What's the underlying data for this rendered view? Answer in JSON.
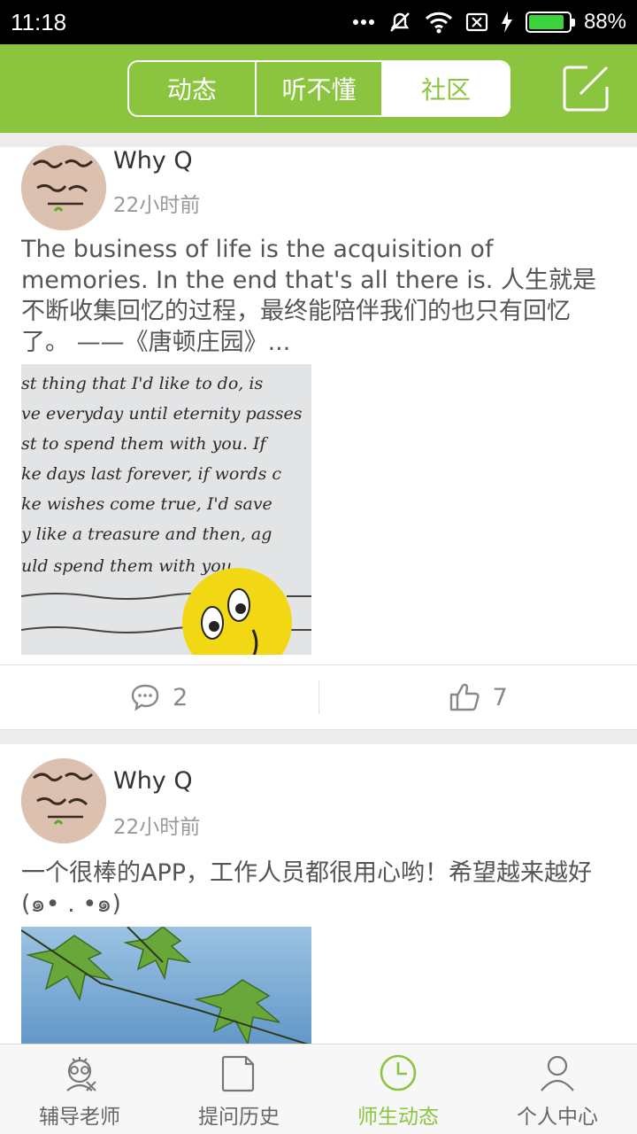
{
  "status": {
    "time": "11:18",
    "battery": "88%",
    "battery_level": 0.88
  },
  "header": {
    "tabs": [
      {
        "label": "动态",
        "active": false
      },
      {
        "label": "听不懂",
        "active": false
      },
      {
        "label": "社区",
        "active": true
      }
    ],
    "compose_icon": "compose-icon"
  },
  "posts": [
    {
      "user": "Why Q",
      "time": "22小时前",
      "text": "The business of life is the acquisition of memories. In the end that's all there is. 人生就是不断收集回忆的过程，最终能陪伴我们的也只有回忆了。 ——《唐顿庄园》...",
      "image_lines": [
        "st thing that I'd like to do, is",
        "ve everyday until eternity passes",
        "st to spend them with you. If",
        "ke days last forever, if words c",
        "ke wishes come true, I'd save",
        "y like a treasure and then, ag",
        "uld spend them with you."
      ],
      "comments": "2",
      "likes": "7"
    },
    {
      "user": "Why Q",
      "time": "22小时前",
      "text": "一个很棒的APP，工作人员都很用心哟！希望越来越好(๑• . •๑)"
    }
  ],
  "tabbar": [
    {
      "label": "辅导老师",
      "icon": "teacher-icon",
      "active": false
    },
    {
      "label": "提问历史",
      "icon": "document-icon",
      "active": false
    },
    {
      "label": "师生动态",
      "icon": "clock-icon",
      "active": true
    },
    {
      "label": "个人中心",
      "icon": "person-icon",
      "active": false
    }
  ],
  "colors": {
    "accent": "#8bc540",
    "status_bg": "#000000",
    "battery": "#3bd23b"
  }
}
